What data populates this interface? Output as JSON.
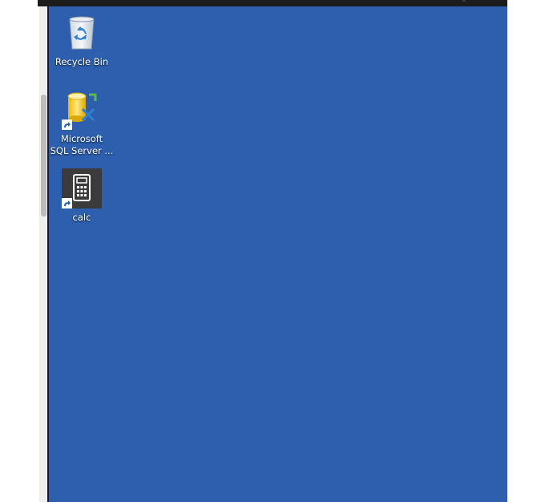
{
  "desktop": {
    "background_color": "#2d5fae",
    "icons": [
      {
        "label": "Recycle Bin",
        "icon": "recycle-bin-icon",
        "shortcut": false
      },
      {
        "label": "Microsoft\nSQL Server ...",
        "icon": "sql-server-icon",
        "shortcut": true
      },
      {
        "label": "calc",
        "icon": "calculator-icon",
        "shortcut": true
      }
    ]
  }
}
